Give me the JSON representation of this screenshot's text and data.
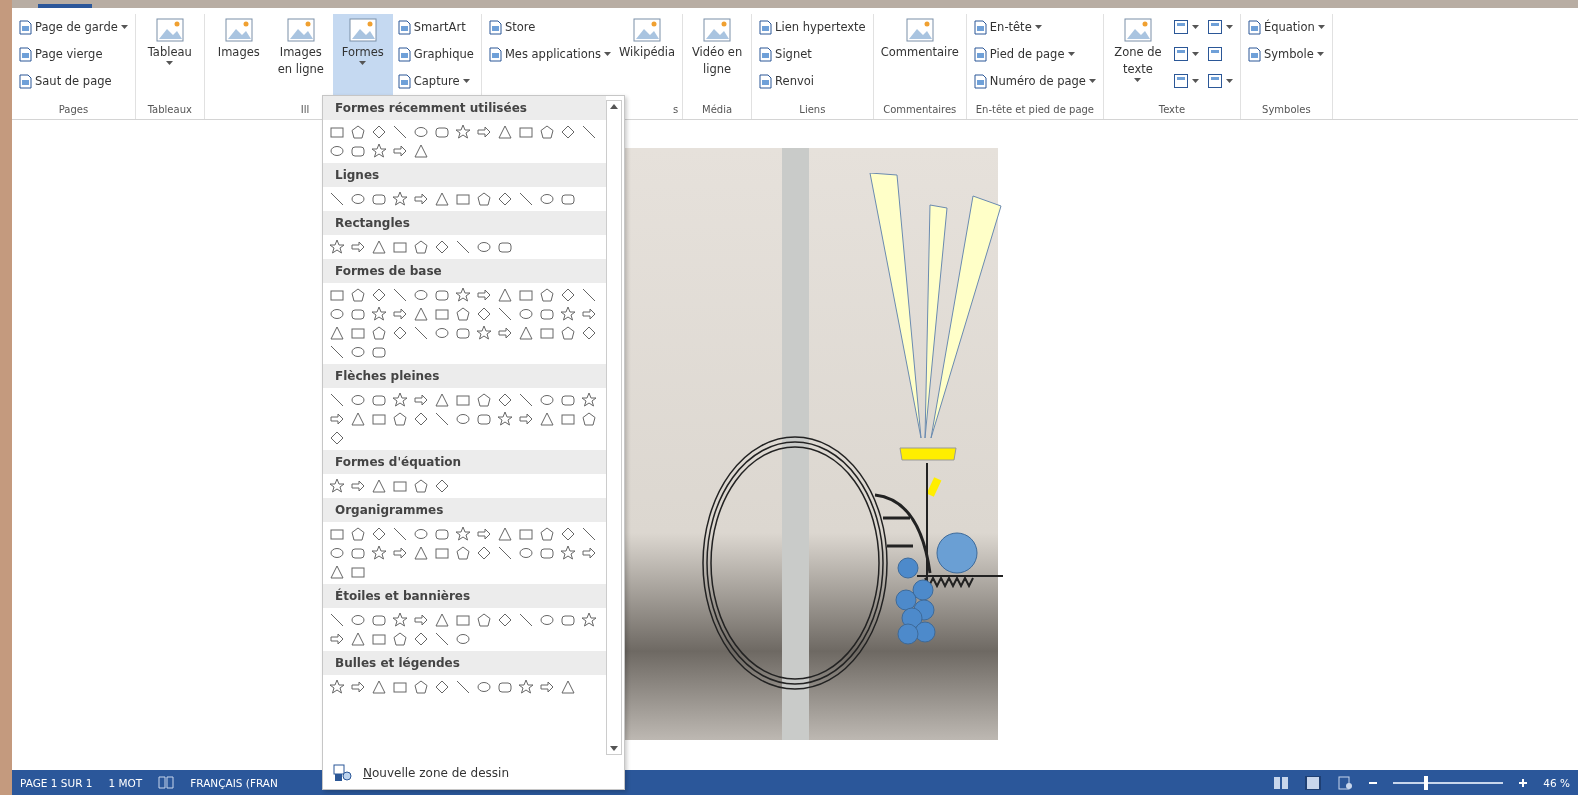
{
  "ribbon": {
    "groups": [
      {
        "label": "Pages",
        "columns": [
          [
            {
              "kind": "small",
              "label": "Page de garde",
              "dropdown": true,
              "pressed": false
            },
            {
              "kind": "small",
              "label": "Page vierge",
              "dropdown": false,
              "pressed": false
            },
            {
              "kind": "small",
              "label": "Saut de page",
              "dropdown": false,
              "pressed": false
            }
          ]
        ]
      },
      {
        "label": "Tableaux",
        "columns": [
          [
            {
              "kind": "large",
              "label": "Tableau",
              "dropdown": true,
              "pressed": false
            }
          ]
        ]
      },
      {
        "label": "Ill",
        "columns": [
          [
            {
              "kind": "large",
              "label": "Images",
              "dropdown": false,
              "pressed": false
            }
          ],
          [
            {
              "kind": "large",
              "label": "Images en ligne",
              "dropdown": false,
              "pressed": false
            }
          ],
          [
            {
              "kind": "large",
              "label": "Formes",
              "dropdown": true,
              "pressed": true
            }
          ],
          [
            {
              "kind": "small",
              "label": "SmartArt",
              "dropdown": false,
              "pressed": false
            },
            {
              "kind": "small",
              "label": "Graphique",
              "dropdown": false,
              "pressed": false
            },
            {
              "kind": "small",
              "label": "Capture",
              "dropdown": true,
              "pressed": false
            }
          ]
        ]
      },
      {
        "label": "s",
        "columns": [
          [
            {
              "kind": "small",
              "label": "Store",
              "dropdown": false,
              "pressed": false
            },
            {
              "kind": "small",
              "label": "Mes applications",
              "dropdown": true,
              "pressed": false
            }
          ],
          [
            {
              "kind": "large",
              "label": "Wikipédia",
              "dropdown": false,
              "pressed": false
            }
          ]
        ]
      },
      {
        "label": "Média",
        "columns": [
          [
            {
              "kind": "large",
              "label": "Vidéo en ligne",
              "dropdown": false,
              "pressed": false
            }
          ]
        ]
      },
      {
        "label": "Liens",
        "columns": [
          [
            {
              "kind": "small",
              "label": "Lien hypertexte",
              "dropdown": false,
              "pressed": false
            },
            {
              "kind": "small",
              "label": "Signet",
              "dropdown": false,
              "pressed": false
            },
            {
              "kind": "small",
              "label": "Renvoi",
              "dropdown": false,
              "pressed": false
            }
          ]
        ]
      },
      {
        "label": "Commentaires",
        "columns": [
          [
            {
              "kind": "large",
              "label": "Commentaire",
              "dropdown": false,
              "pressed": false
            }
          ]
        ]
      },
      {
        "label": "En-tête et pied de page",
        "columns": [
          [
            {
              "kind": "small",
              "label": "En-tête",
              "dropdown": true,
              "pressed": false
            },
            {
              "kind": "small",
              "label": "Pied de page",
              "dropdown": true,
              "pressed": false
            },
            {
              "kind": "small",
              "label": "Numéro de page",
              "dropdown": true,
              "pressed": false
            }
          ]
        ]
      },
      {
        "label": "Texte",
        "columns": [
          [
            {
              "kind": "large",
              "label": "Zone de texte",
              "dropdown": true,
              "pressed": false
            }
          ],
          [
            {
              "kind": "icon",
              "dropdown": true,
              "pressed": false
            },
            {
              "kind": "icon",
              "dropdown": true,
              "pressed": false
            },
            {
              "kind": "icon",
              "dropdown": true,
              "pressed": false
            }
          ],
          [
            {
              "kind": "icon",
              "dropdown": true,
              "pressed": false
            },
            {
              "kind": "icon",
              "dropdown": false,
              "pressed": false
            },
            {
              "kind": "icon",
              "dropdown": true,
              "pressed": false
            }
          ]
        ]
      },
      {
        "label": "Symboles",
        "columns": [
          [
            {
              "kind": "small",
              "label": "Équation",
              "dropdown": true,
              "pressed": false
            },
            {
              "kind": "small",
              "label": "Symbole",
              "dropdown": true,
              "pressed": false
            }
          ]
        ]
      }
    ]
  },
  "shapes_menu": {
    "sections": [
      {
        "title": "Formes récemment utilisées"
      },
      {
        "title": "Lignes"
      },
      {
        "title": "Rectangles"
      },
      {
        "title": "Formes de base"
      },
      {
        "title": "Flèches pleines"
      },
      {
        "title": "Formes d'équation"
      },
      {
        "title": "Organigrammes"
      },
      {
        "title": "Étoiles et bannières"
      },
      {
        "title": "Bulles et légendes"
      }
    ],
    "footer": "Nouvelle zone de dessin"
  },
  "status_bar": {
    "page": "PAGE 1 SUR 1",
    "words": "1 MOT",
    "language": "FRANÇAIS (FRAN",
    "zoom": {
      "level": 0.3
    },
    "zoom_text": "46 %"
  }
}
